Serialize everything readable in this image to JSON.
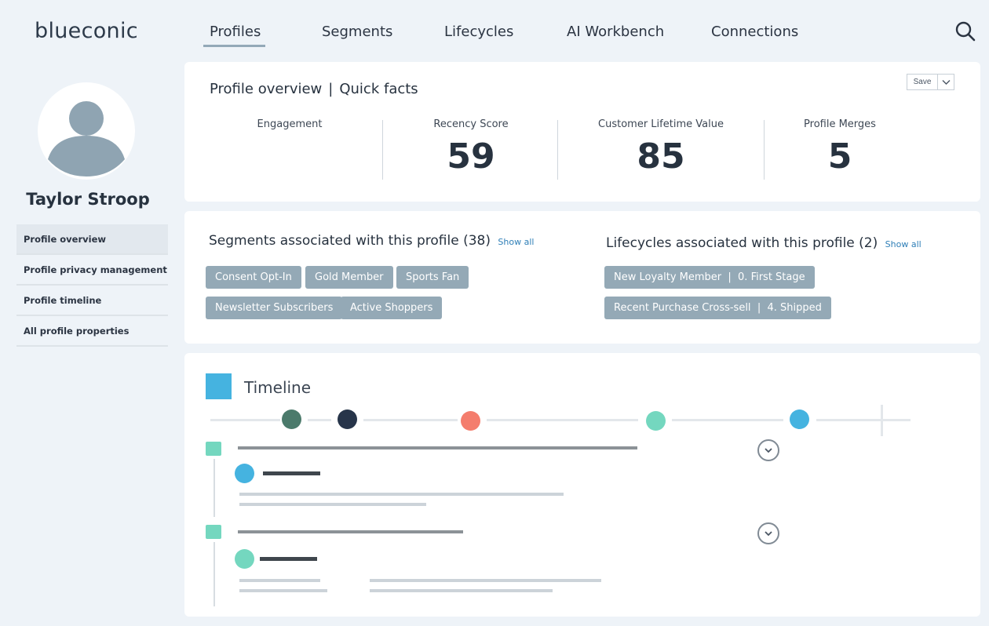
{
  "app": {
    "logo": "blueconic"
  },
  "nav": {
    "items": [
      {
        "label": "Profiles",
        "active": true
      },
      {
        "label": "Segments"
      },
      {
        "label": "Lifecycles"
      },
      {
        "label": "AI Workbench"
      },
      {
        "label": "Connections"
      }
    ],
    "search_icon": "search-icon"
  },
  "profile": {
    "name": "Taylor Stroop",
    "avatar_icon": "person-icon"
  },
  "sidebar": {
    "items": [
      {
        "label": "Profile overview",
        "active": true
      },
      {
        "label": "Profile privacy management"
      },
      {
        "label": "Profile timeline"
      },
      {
        "label": "All profile properties"
      }
    ]
  },
  "quick_facts": {
    "title_left": "Profile overview",
    "separator": "|",
    "title_right": "Quick facts",
    "save_label": "Save",
    "metrics": [
      {
        "label": "Engagement",
        "value": ""
      },
      {
        "label": "Recency Score",
        "value": "59"
      },
      {
        "label": "Customer Lifetime Value",
        "value": "85"
      },
      {
        "label": "Profile Merges",
        "value": "5"
      }
    ]
  },
  "segments": {
    "title": "Segments associated with this profile (38)",
    "show_all": "Show all",
    "tags": [
      "Consent Opt-In",
      "Gold Member",
      "Sports Fan",
      "Newsletter Subscribers",
      "Active Shoppers"
    ]
  },
  "lifecycles": {
    "title": "Lifecycles associated with this profile (2)",
    "show_all": "Show all",
    "tags": [
      "New Loyalty Member  |  0. First Stage",
      "Recent Purchase Cross-sell  |  4. Shipped"
    ]
  },
  "timeline": {
    "title": "Timeline",
    "colors": {
      "accent": "#45b3e0",
      "dark_green": "#4b7a6b",
      "navy": "#27354a",
      "coral": "#f47d6d",
      "mint": "#74d7bf",
      "blue": "#45b3e0"
    }
  }
}
